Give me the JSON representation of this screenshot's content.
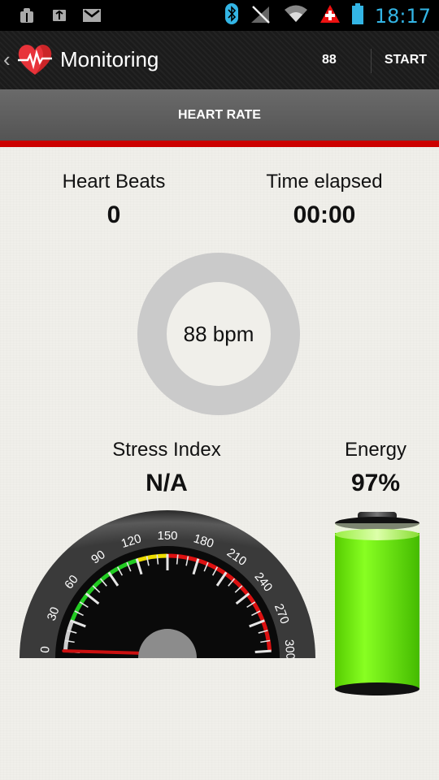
{
  "status_bar": {
    "time": "18:17",
    "icons": [
      "android-debug-icon",
      "usb-icon",
      "gmail-icon",
      "bluetooth-icon",
      "no-signal-icon",
      "wifi-icon",
      "alert-icon",
      "battery-icon"
    ]
  },
  "action_bar": {
    "title": "Monitoring",
    "count": "88",
    "start_label": "START"
  },
  "tabs": [
    {
      "label": "HEART RATE",
      "selected": true
    }
  ],
  "metrics": {
    "heart_beats": {
      "label": "Heart Beats",
      "value": "0"
    },
    "time_elapsed": {
      "label": "Time elapsed",
      "value": "00:00"
    },
    "bpm": {
      "label": "88 bpm"
    },
    "stress_index": {
      "label": "Stress Index",
      "value": "N/A"
    },
    "energy": {
      "label": "Energy",
      "value": "97%",
      "level": 0.97
    }
  },
  "gauge": {
    "min": 0,
    "max": 300,
    "ticks": [
      "0",
      "30",
      "60",
      "90",
      "120",
      "150",
      "180",
      "210",
      "240",
      "270",
      "300"
    ],
    "needle_value": 0,
    "zones": [
      {
        "from": 0,
        "to": 30,
        "color": "#cccccc"
      },
      {
        "from": 30,
        "to": 120,
        "color": "#22cc22"
      },
      {
        "from": 120,
        "to": 150,
        "color": "#eedd00"
      },
      {
        "from": 150,
        "to": 300,
        "color": "#dd1111"
      }
    ]
  },
  "colors": {
    "accent": "#cc0000",
    "status_time": "#33b5e5",
    "battery_fill": "#77ee00"
  }
}
